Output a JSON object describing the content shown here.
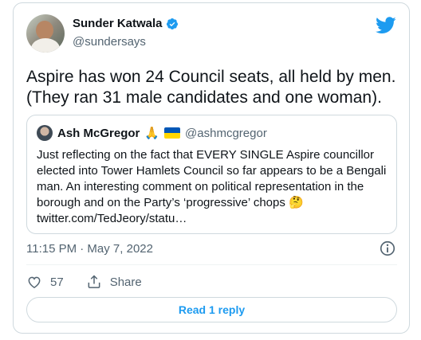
{
  "author": {
    "display_name": "Sunder Katwala",
    "handle": "@sundersays",
    "verified": true
  },
  "tweet": {
    "text": "Aspire has won 24 Council seats, all held by men. (They ran 31 male candidates and one woman).",
    "timestamp": "11:15 PM · May 7, 2022"
  },
  "quoted": {
    "display_name": "Ash McGregor",
    "emoji": "🙏",
    "flag": "ukraine-flag",
    "handle": "@ashmcgregor",
    "text": "Just reflecting on the fact that EVERY  SINGLE Aspire councillor elected into Tower Hamlets Council so far appears to be a Bengali man. An interesting comment on political representation in the borough and on the Party’s ‘progressive’ chops 🤔 twitter.com/TedJeory/statu…"
  },
  "actions": {
    "like_count": "57",
    "share_label": "Share"
  },
  "reply_button_label": "Read 1 reply",
  "icons": {
    "brand": "twitter-bird-icon",
    "verified": "verified-badge-icon",
    "info": "info-icon",
    "like": "heart-icon",
    "share": "share-icon"
  },
  "colors": {
    "accent": "#1d9bf0",
    "secondary_text": "#536471",
    "border": "#cfd9de"
  }
}
